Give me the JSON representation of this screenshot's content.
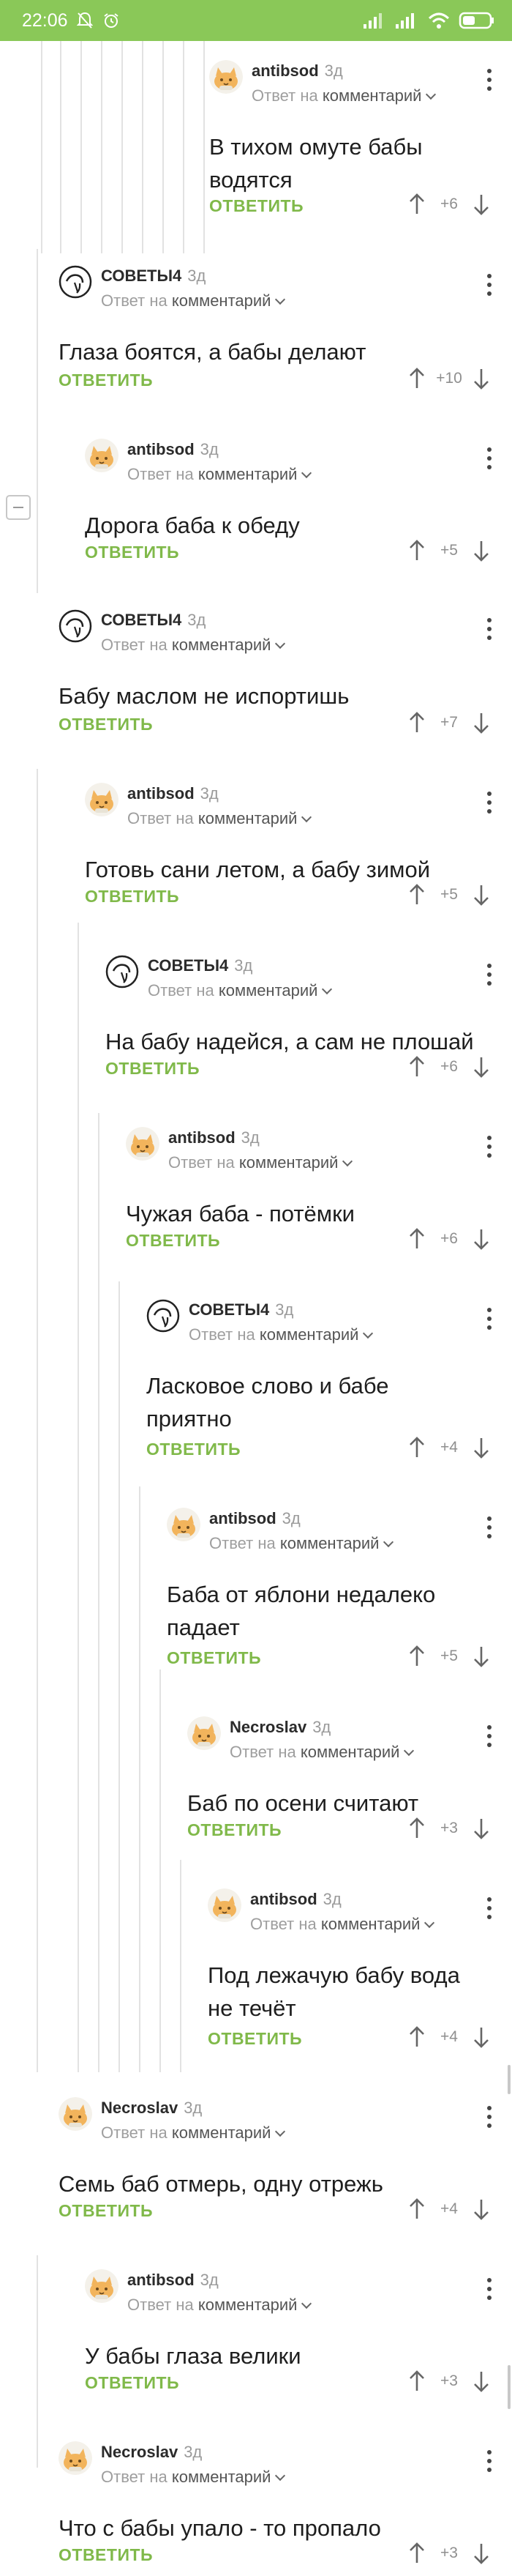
{
  "status_bar": {
    "time": "22:06",
    "battery_icon": "battery-icon",
    "wifi_icon": "wifi-icon",
    "signal_icon": "signal-icon",
    "muted_icon": "bell-off-icon",
    "alarm_icon": "alarm-icon"
  },
  "labels": {
    "reply_to_prefix": "Ответ на",
    "reply_to_target": "комментарий",
    "reply_button": "ОТВЕТИТЬ",
    "age": "3д"
  },
  "colors": {
    "accent": "#80b94a",
    "status_bar": "#8ac858"
  },
  "comments": [
    {
      "author": "antibsod",
      "avatar": "cat-avatar",
      "text_lines": [
        "В тихом омуте бабы",
        "водятся"
      ],
      "score": "+6"
    },
    {
      "author": "СОВЕТЫ4",
      "avatar": "sovety-avatar",
      "text_lines": [
        "Глаза боятся, а бабы делают"
      ],
      "score": "+10"
    },
    {
      "author": "antibsod",
      "avatar": "cat-avatar",
      "text_lines": [
        "Дорога баба к обеду"
      ],
      "score": "+5"
    },
    {
      "author": "СОВЕТЫ4",
      "avatar": "sovety-avatar",
      "text_lines": [
        "Бабу маслом не испортишь"
      ],
      "score": "+7"
    },
    {
      "author": "antibsod",
      "avatar": "cat-avatar",
      "text_lines": [
        "Готовь сани летом, а бабу зимой"
      ],
      "score": "+5"
    },
    {
      "author": "СОВЕТЫ4",
      "avatar": "sovety-avatar",
      "text_lines": [
        "На бабу надейся, а сам не плошай"
      ],
      "score": "+6"
    },
    {
      "author": "antibsod",
      "avatar": "cat-avatar",
      "text_lines": [
        "Чужая баба - потёмки"
      ],
      "score": "+6"
    },
    {
      "author": "СОВЕТЫ4",
      "avatar": "sovety-avatar",
      "text_lines": [
        "Ласковое слово и бабе",
        "приятно"
      ],
      "score": "+4"
    },
    {
      "author": "antibsod",
      "avatar": "cat-avatar",
      "text_lines": [
        "Баба от яблони недалеко",
        "падает"
      ],
      "score": "+5"
    },
    {
      "author": "Necroslav",
      "avatar": "cat-avatar",
      "text_lines": [
        "Баб по осени считают"
      ],
      "score": "+3"
    },
    {
      "author": "antibsod",
      "avatar": "cat-avatar",
      "text_lines": [
        "Под лежачую бабу вода",
        "не течёт"
      ],
      "score": "+4"
    },
    {
      "author": "Necroslav",
      "avatar": "cat-avatar",
      "text_lines": [
        "Семь баб отмерь, одну отрежь"
      ],
      "score": "+4"
    },
    {
      "author": "antibsod",
      "avatar": "cat-avatar",
      "text_lines": [
        "У бабы глаза велики"
      ],
      "score": "+3"
    },
    {
      "author": "Necroslav",
      "avatar": "cat-avatar",
      "text_lines": [
        "Что с бабы упало - то пропало"
      ],
      "score": "+3"
    }
  ]
}
